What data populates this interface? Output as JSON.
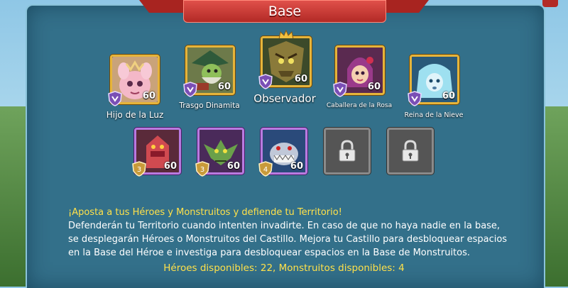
{
  "header": {
    "title": "Base"
  },
  "heroes": [
    {
      "name": "Hijo de la Luz",
      "level": "60",
      "rank": ""
    },
    {
      "name": "Trasgo Dinamita",
      "level": "60",
      "rank": ""
    },
    {
      "name": "Observador",
      "level": "60",
      "rank": ""
    },
    {
      "name": "Caballera de la Rosa",
      "level": "60",
      "rank": ""
    },
    {
      "name": "Reina de la Nieve",
      "level": "60",
      "rank": ""
    }
  ],
  "monsters": [
    {
      "level": "60",
      "rank": "3"
    },
    {
      "level": "60",
      "rank": "3"
    },
    {
      "level": "60",
      "rank": "4"
    }
  ],
  "description": {
    "title": "¡Aposta a tus Héroes y Monstruitos y defiende tu Territorio!",
    "body": "Defenderán tu Territorio cuando intenten invadirte. En caso de que no haya nadie en la base, se desplegarán Héroes o Monstruitos del Castillo. Mejora tu Castillo para desbloquear espacios en la Base del Héroe e investiga para desbloquear espacios en la Base de Monstruitos."
  },
  "available": "Héroes disponibles: 22, Monstruitos disponibles: 4",
  "colors": {
    "accent": "#e6b43a",
    "monster_frame": "#b97ae0",
    "panel": "#33708a",
    "banner": "#c73a34",
    "highlight_text": "#ffe14a"
  }
}
